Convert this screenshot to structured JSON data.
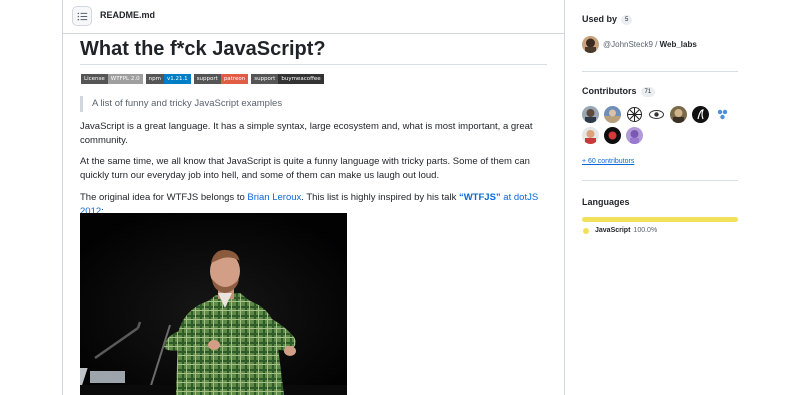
{
  "readme": {
    "file_label": "README.md",
    "title": "What the f*ck JavaScript?",
    "badges": [
      {
        "label": "License",
        "value": "WTFPL 2.0"
      },
      {
        "label": "npm",
        "value": "v1.21.1"
      },
      {
        "label": "support",
        "value": "patreon"
      },
      {
        "label": "support",
        "value": "buymeacoffee"
      }
    ],
    "quote": "A list of funny and tricky JavaScript examples",
    "p1": "JavaScript is a great language. It has a simple syntax, large ecosystem and, what is most important, a great community.",
    "p2": "At the same time, we all know that JavaScript is quite a funny language with tricky parts. Some of them can quickly turn our everyday job into hell, and some of them can make us laugh out loud.",
    "p3_before": "The original idea for WTFJS belongs to ",
    "p3_link1": "Brian Leroux",
    "p3_middle": ". This list is highly inspired by his talk ",
    "p3_link2": "“WTFJS”",
    "p3_link3": " at dotJS 2012",
    "p3_end": ":"
  },
  "sidebar": {
    "used_by": {
      "heading": "Used by",
      "count": "5",
      "user": "@JohnSteck9",
      "separator": " / ",
      "repo": "Web_labs"
    },
    "contributors": {
      "heading": "Contributors",
      "count": "71",
      "more": "+ 60 contributors"
    },
    "languages": {
      "heading": "Languages",
      "items": [
        {
          "name": "JavaScript",
          "percent": "100.0%",
          "color": "#f1e05a"
        }
      ]
    }
  },
  "colors": {
    "link": "#0969da",
    "border": "#d0d7de",
    "javascript": "#f1e05a"
  },
  "icons": {
    "toc": "list-unordered-icon"
  }
}
